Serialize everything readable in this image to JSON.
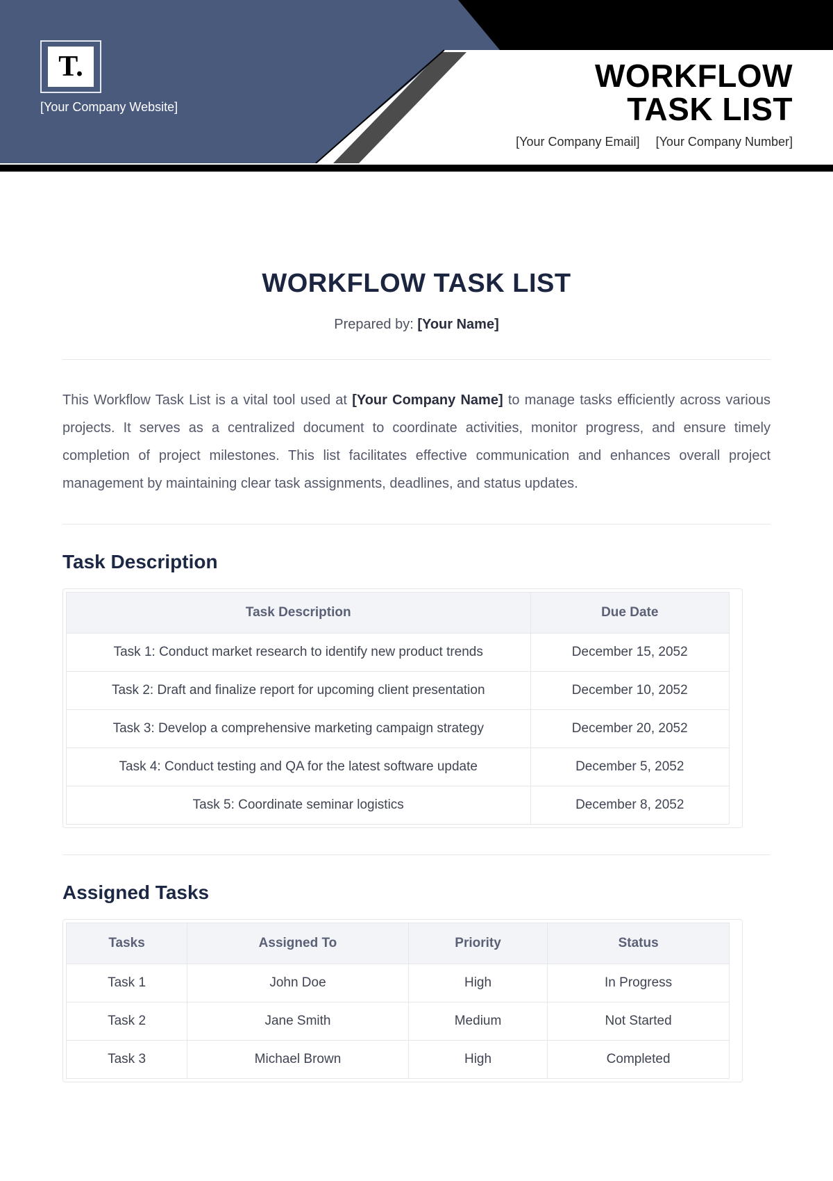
{
  "banner": {
    "logo_text": "T.",
    "website_placeholder": "[Your Company Website]",
    "title_line1": "WORKFLOW",
    "title_line2": "TASK LIST",
    "email_placeholder": "[Your Company Email]",
    "phone_placeholder": "[Your Company Number]"
  },
  "doc": {
    "title": "WORKFLOW TASK LIST",
    "prepared_label": "Prepared by: ",
    "prepared_value": "[Your Name]",
    "intro_pre": "This Workflow Task List is a vital tool used at ",
    "intro_company": "[Your Company Name]",
    "intro_post": " to manage tasks efficiently across various projects. It serves as a centralized document to coordinate activities, monitor progress, and ensure timely completion of project milestones. This list facilitates effective communication and enhances overall project management by maintaining clear task assignments, deadlines, and status updates."
  },
  "task_desc": {
    "heading": "Task Description",
    "col_task": "Task Description",
    "col_due": "Due Date",
    "rows": [
      {
        "desc": "Task 1: Conduct market research to identify new product trends",
        "due": "December 15, 2052"
      },
      {
        "desc": "Task 2: Draft and finalize report for upcoming client presentation",
        "due": "December 10, 2052"
      },
      {
        "desc": "Task 3: Develop a comprehensive marketing campaign strategy",
        "due": "December 20, 2052"
      },
      {
        "desc": "Task 4: Conduct testing and QA for the latest software update",
        "due": "December 5, 2052"
      },
      {
        "desc": "Task 5: Coordinate seminar logistics",
        "due": "December 8, 2052"
      }
    ]
  },
  "assigned": {
    "heading": "Assigned Tasks",
    "col_task": "Tasks",
    "col_assignee": "Assigned To",
    "col_priority": "Priority",
    "col_status": "Status",
    "rows": [
      {
        "task": "Task 1",
        "assignee": "John Doe",
        "priority": "High",
        "status": "In Progress"
      },
      {
        "task": "Task 2",
        "assignee": "Jane Smith",
        "priority": "Medium",
        "status": "Not Started"
      },
      {
        "task": "Task 3",
        "assignee": "Michael Brown",
        "priority": "High",
        "status": "Completed"
      }
    ]
  }
}
